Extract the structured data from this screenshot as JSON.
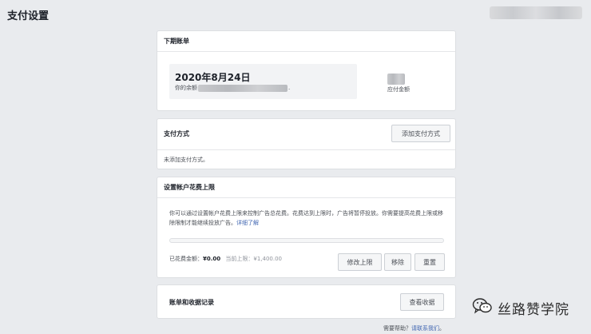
{
  "page": {
    "title": "支付设置"
  },
  "next_bill": {
    "header": "下期账单",
    "date": "2020年8月24日",
    "balance_prefix": "你的余额",
    "balance_suffix": ".",
    "amount_label": "应付金额"
  },
  "payment_method": {
    "header": "支付方式",
    "add_button": "添加支付方式",
    "empty_text": "未添加支付方式。"
  },
  "spending_limit": {
    "header": "设置帐户花费上限",
    "description": "你可以通过设置帐户花费上限来控制广告总花费。花费达到上限时，广告将暂停投放。你需要提高花费上限或移除限制才能继续投放广告。",
    "learn_more": "详细了解",
    "progress": 0,
    "spent_label": "已花费金额：",
    "spent_value": "¥0.00",
    "limit_text": "当前上限：¥1,400.00",
    "modify_button": "修改上限",
    "remove_button": "移除",
    "reset_button": "重置"
  },
  "billing_history": {
    "header": "账单和收据记录",
    "view_button": "查看收据"
  },
  "help": {
    "prefix": "需要帮助？",
    "link": "请联系我们",
    "suffix": "。"
  },
  "watermark": {
    "text": "丝路赞学院"
  }
}
